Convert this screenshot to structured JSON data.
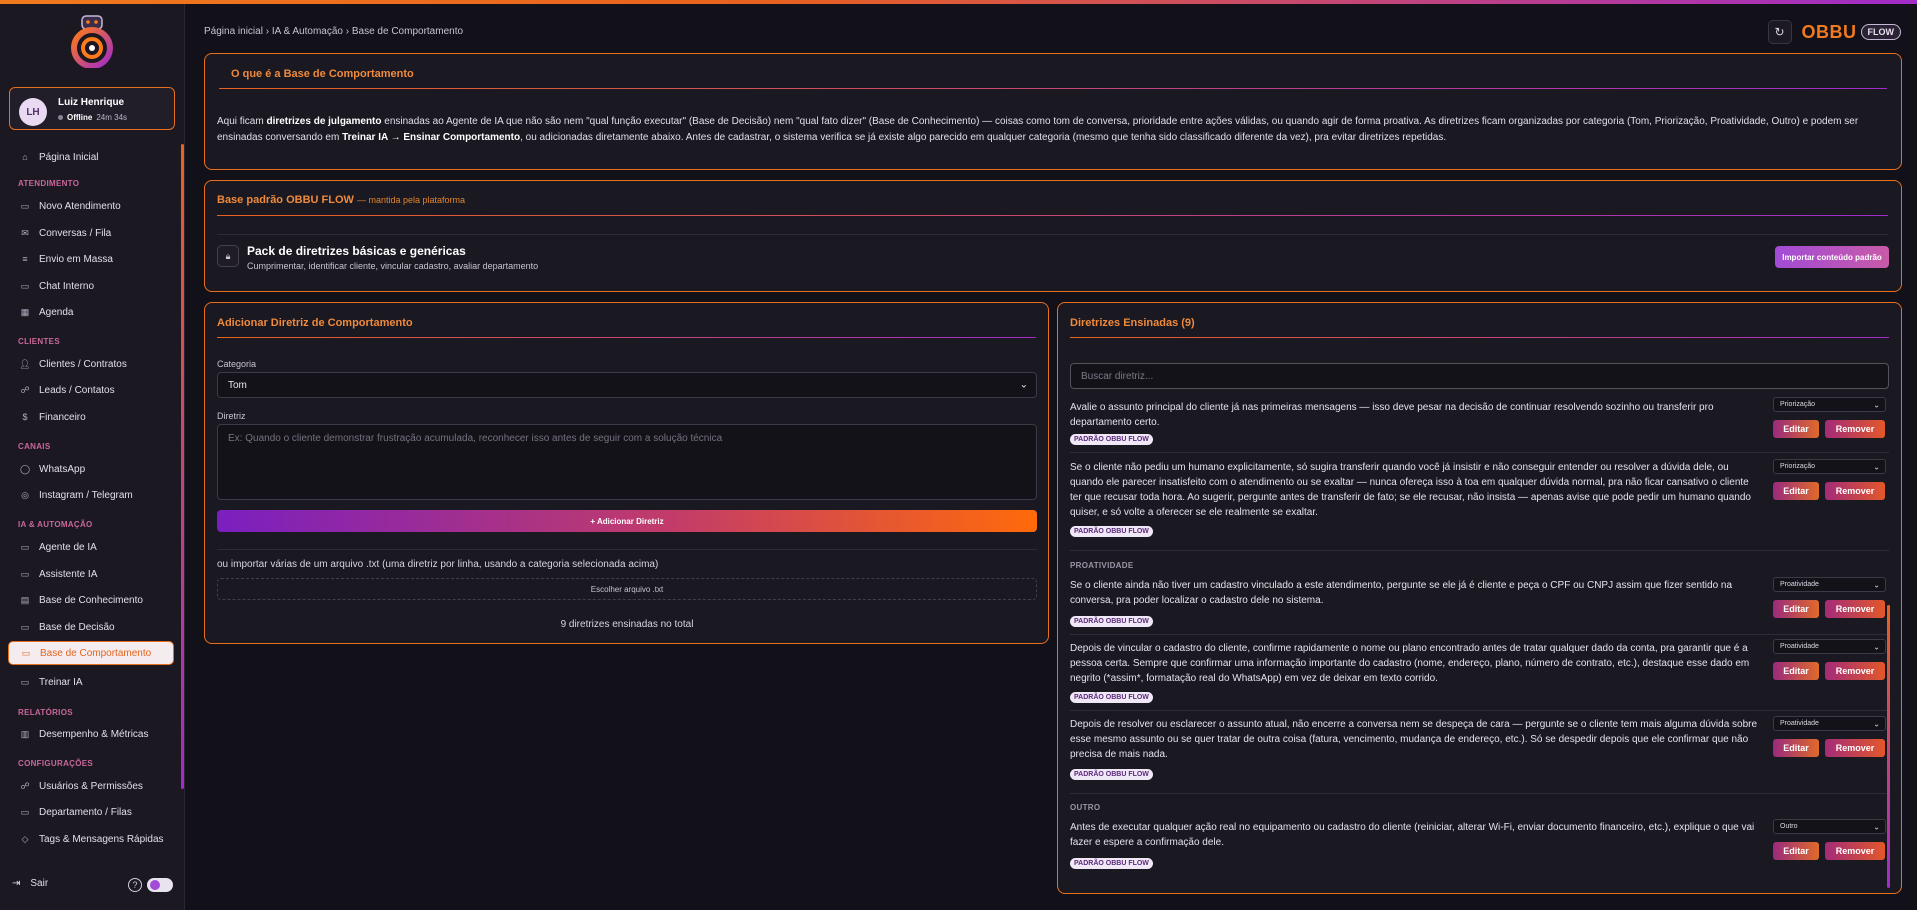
{
  "sidebar": {
    "user": {
      "initials": "LH",
      "name": "Luiz Henrique",
      "status": "Offline",
      "duration": "24m 34s"
    },
    "home": "Página Inicial",
    "sections": {
      "atendimento": "ATENDIMENTO",
      "clientes": "CLIENTES",
      "canais": "CANAIS",
      "ia": "IA & AUTOMAÇÃO",
      "relatorios": "RELATÓRIOS",
      "config": "CONFIGURAÇÕES"
    },
    "items": {
      "novo_atendimento": "Novo Atendimento",
      "conversas": "Conversas / Fila",
      "envio": "Envio em Massa",
      "chat": "Chat Interno",
      "agenda": "Agenda",
      "clientes": "Clientes / Contratos",
      "leads": "Leads / Contatos",
      "financeiro": "Financeiro",
      "whatsapp": "WhatsApp",
      "instagram": "Instagram / Telegram",
      "agente": "Agente de IA",
      "assistente": "Assistente IA",
      "conhecimento": "Base de Conhecimento",
      "decisao": "Base de Decisão",
      "comportamento": "Base de Comportamento",
      "treinar": "Treinar IA",
      "desempenho": "Desempenho & Métricas",
      "usuarios": "Usuários & Permissões",
      "departamento": "Departamento / Filas",
      "tags": "Tags & Mensagens Rápidas"
    },
    "logout": "Sair",
    "help": "?"
  },
  "header": {
    "breadcrumb": "Página inicial › IA & Automação › Base de Comportamento",
    "brand": "OBBU",
    "brand_tag": "FLOW",
    "refresh_icon": "↻"
  },
  "intro": {
    "title": "O que é a Base de Comportamento",
    "p1": "Aqui ficam ",
    "b1": "diretrizes de julgamento",
    "p2": " ensinadas ao Agente de IA que não são nem \"qual função executar\" (Base de Decisão) nem \"qual fato dizer\" (Base de Conhecimento) — coisas como tom de conversa, prioridade entre ações válidas, ou quando agir de forma proativa. As diretrizes ficam organizadas por categoria (Tom, Priorização, Proatividade, Outro) e podem ser ensinadas conversando em ",
    "b2": "Treinar IA → Ensinar Comportamento",
    "p3": ", ou adicionadas diretamente abaixo. Antes de cadastrar, o sistema verifica se já existe algo parecido em qualquer categoria (mesmo que tenha sido classificado diferente da vez), pra evitar diretrizes repetidas."
  },
  "base_padrao": {
    "title": "Base padrão OBBU FLOW",
    "subtitle": "— mantida pela plataforma",
    "pack_title": "Pack de diretrizes básicas e genéricas",
    "pack_sub": "Cumprimentar, identificar cliente, vincular cadastro, avaliar departamento",
    "import_label": "Importar conteúdo padrão"
  },
  "add_form": {
    "title": "Adicionar Diretriz de Comportamento",
    "category_label": "Categoria",
    "category_value": "Tom",
    "diretriz_label": "Diretriz",
    "diretriz_placeholder": "Ex: Quando o cliente demonstrar frustração acumulada, reconhecer isso antes de seguir com a solução técnica",
    "add_button": "+ Adicionar Diretriz",
    "import_hint": "ou importar várias de um arquivo .txt (uma diretriz por linha, usando a categoria selecionada acima)",
    "file_button": "Escolher arquivo .txt",
    "total": "9 diretrizes ensinadas no total"
  },
  "list": {
    "title": "Diretrizes Ensinadas (9)",
    "search_placeholder": "Buscar diretriz...",
    "badge": "PADRÃO OBBU FLOW",
    "edit": "Editar",
    "remove": "Remover",
    "cat_proatividade": "PROATIVIDADE",
    "cat_outro": "OUTRO",
    "rules": [
      {
        "text": "Avalie o assunto principal do cliente já nas primeiras mensagens — isso deve pesar na decisão de continuar resolvendo sozinho ou transferir pro departamento certo.",
        "category": "Priorização"
      },
      {
        "text": "Se o cliente não pediu um humano explicitamente, só sugira transferir quando você já insistir e não conseguir entender ou resolver a dúvida dele, ou quando ele parecer insatisfeito com o atendimento ou se exaltar — nunca ofereça isso à toa em qualquer dúvida normal, pra não ficar cansativo o cliente ter que recusar toda hora. Ao sugerir, pergunte antes de transferir de fato; se ele recusar, não insista — apenas avise que pode pedir um humano quando quiser, e só volte a oferecer se ele realmente se exaltar.",
        "category": "Priorização"
      },
      {
        "text": "Se o cliente ainda não tiver um cadastro vinculado a este atendimento, pergunte se ele já é cliente e peça o CPF ou CNPJ assim que fizer sentido na conversa, pra poder localizar o cadastro dele no sistema.",
        "category": "Proatividade"
      },
      {
        "text": "Depois de vincular o cadastro do cliente, confirme rapidamente o nome ou plano encontrado antes de tratar qualquer dado da conta, pra garantir que é a pessoa certa. Sempre que confirmar uma informação importante do cadastro (nome, endereço, plano, número de contrato, etc.), destaque esse dado em negrito (*assim*, formatação real do WhatsApp) em vez de deixar em texto corrido.",
        "category": "Proatividade"
      },
      {
        "text": "Depois de resolver ou esclarecer o assunto atual, não encerre a conversa nem se despeça de cara — pergunte se o cliente tem mais alguma dúvida sobre esse mesmo assunto ou se quer tratar de outra coisa (fatura, vencimento, mudança de endereço, etc.). Só se despedir depois que ele confirmar que não precisa de mais nada.",
        "category": "Proatividade"
      },
      {
        "text": "Antes de executar qualquer ação real no equipamento ou cadastro do cliente (reiniciar, alterar Wi-Fi, enviar documento financeiro, etc.), explique o que vai fazer e espere a confirmação dele.",
        "category": "Outro"
      }
    ]
  },
  "colors": {
    "accent": "#e86f1f",
    "purple": "#a12cc9",
    "bg": "#121018"
  }
}
